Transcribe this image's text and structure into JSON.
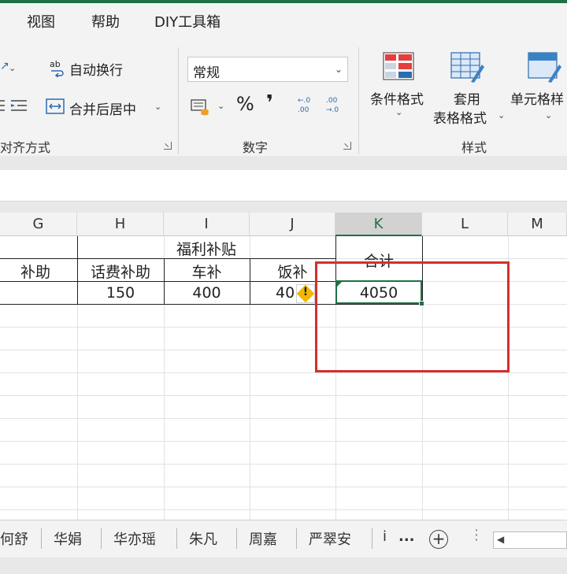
{
  "ribbon": {
    "tabs": [
      "视图",
      "帮助",
      "DIY工具箱"
    ],
    "alignment": {
      "wrap_text": "自动换行",
      "merge_center": "合并后居中",
      "group_label": "对齐方式"
    },
    "number": {
      "format_value": "常规",
      "percent": "%",
      "comma": "❜",
      "inc_decimal": "←.0 .00",
      "dec_decimal": ".00 →.0",
      "group_label": "数字"
    },
    "styles": {
      "conditional_format": "条件格式",
      "table_format_1": "套用",
      "table_format_2": "表格格式",
      "cell_styles": "单元格样",
      "group_label": "样式"
    }
  },
  "sheet": {
    "columns": [
      "G",
      "H",
      "I",
      "J",
      "K",
      "L",
      "M"
    ],
    "merged_header": "福利补贴",
    "total_header": "合计",
    "subheaders": [
      "补助",
      "话费补助",
      "车补",
      "饭补"
    ],
    "values": [
      "150",
      "400",
      "40",
      "4050"
    ]
  },
  "sheet_tabs": [
    "何舒",
    "华娟",
    "华亦瑶",
    "朱凡",
    "周嘉",
    "严翠安",
    "i",
    "..."
  ],
  "colors": {
    "accent": "#1e7145",
    "highlight": "#d32f2f"
  }
}
